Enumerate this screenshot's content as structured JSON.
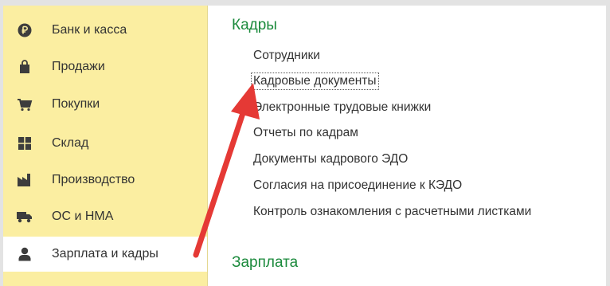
{
  "sidebar": {
    "items": [
      {
        "label": "Банк и касса",
        "icon": "ruble-icon"
      },
      {
        "label": "Продажи",
        "icon": "shopping-bag-icon"
      },
      {
        "label": "Покупки",
        "icon": "cart-icon"
      },
      {
        "label": "Склад",
        "icon": "warehouse-icon"
      },
      {
        "label": "Производство",
        "icon": "factory-icon"
      },
      {
        "label": "ОС и НМА",
        "icon": "truck-icon"
      },
      {
        "label": "Зарплата и кадры",
        "icon": "person-icon",
        "active": true
      }
    ]
  },
  "main": {
    "sections": [
      {
        "title": "Кадры",
        "links": [
          "Сотрудники",
          "Кадровые документы",
          "Электронные трудовые книжки",
          "Отчеты по кадрам",
          "Документы кадрового ЭДО",
          "Согласия на присоединение к КЭДО",
          "Контроль ознакомления с расчетными листками"
        ],
        "focused_link": "Кадровые документы"
      },
      {
        "title": "Зарплата",
        "links": []
      }
    ]
  },
  "colors": {
    "sidebar_bg": "#fbeea1",
    "section_title": "#1b8a3c",
    "arrow": "#e53935",
    "icon": "#3d3d3d"
  }
}
